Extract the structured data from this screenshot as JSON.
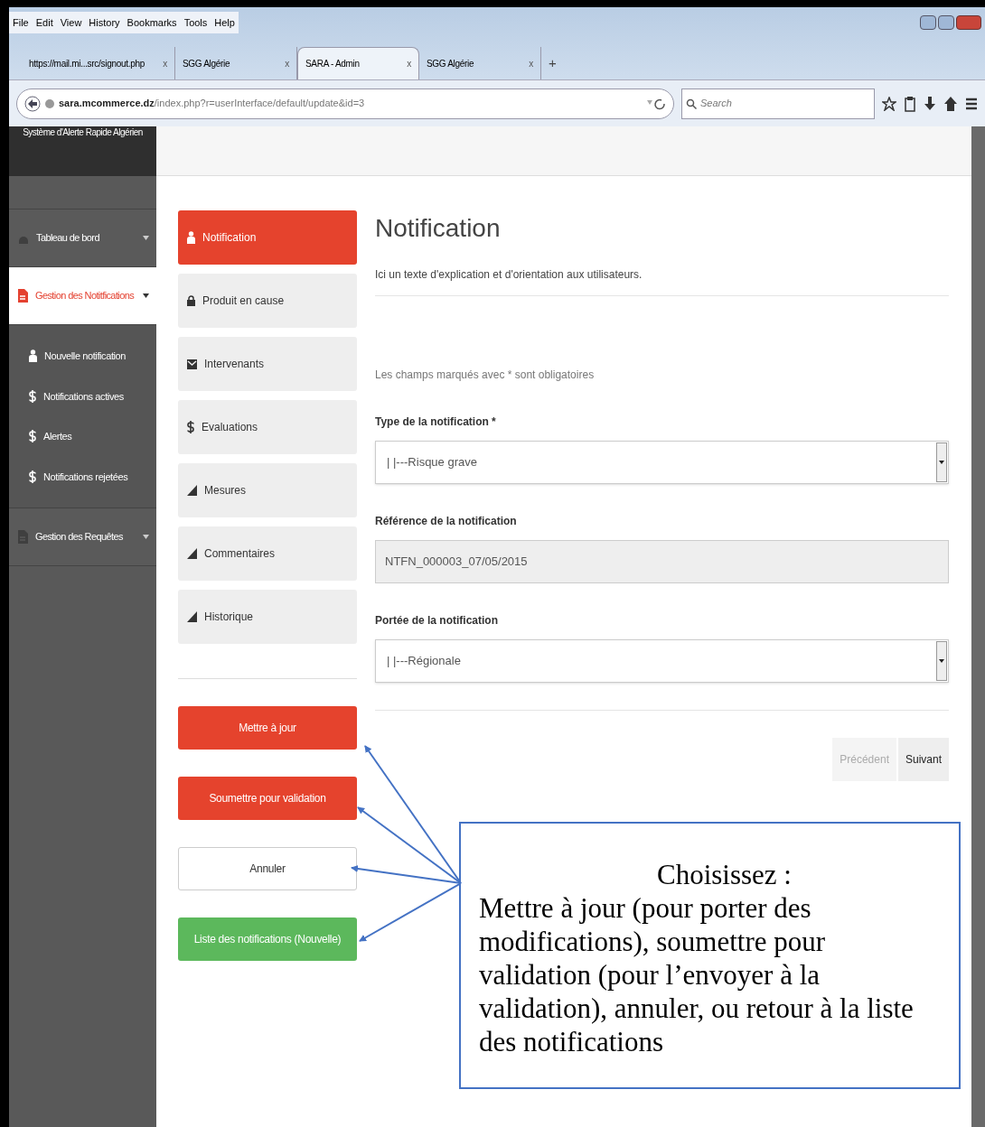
{
  "browser": {
    "menu": [
      "File",
      "Edit",
      "View",
      "History",
      "Bookmarks",
      "Tools",
      "Help"
    ],
    "tabs": [
      {
        "label": "https://mail.mi...src/signout.php",
        "close": "x",
        "selected": false
      },
      {
        "label": "SGG Algérie",
        "close": "x",
        "selected": false
      },
      {
        "label": "SARA - Admin",
        "close": "x",
        "selected": true
      },
      {
        "label": "SGG Algérie",
        "close": "x",
        "selected": false
      }
    ],
    "new_tab": "+",
    "address": {
      "host": "sara.mcommerce.dz",
      "path": "/index.php?r=userInterface/default/update&id=3"
    },
    "search": {
      "placeholder": "Search"
    }
  },
  "sidebar": {
    "brand": "Système d'Alerte Rapide Algérien",
    "items": [
      {
        "label": "Tableau de bord",
        "selected": false,
        "expanded": false
      },
      {
        "label": "Gestion des Notitfications",
        "selected": true,
        "expanded": true,
        "children": [
          {
            "label": "Nouvelle notification"
          },
          {
            "label": "Notifications actives"
          },
          {
            "label": "Alertes"
          },
          {
            "label": "Notifications rejetées"
          }
        ]
      },
      {
        "label": "Gestion des Requêtes",
        "selected": false,
        "expanded": false
      }
    ]
  },
  "steps": [
    {
      "label": "Notification",
      "selected": true
    },
    {
      "label": "Produit en cause",
      "selected": false
    },
    {
      "label": "Intervenants",
      "selected": false
    },
    {
      "label": "Evaluations",
      "selected": false
    },
    {
      "label": "Mesures",
      "selected": false
    },
    {
      "label": "Commentaires",
      "selected": false
    },
    {
      "label": "Historique",
      "selected": false
    }
  ],
  "actions": [
    {
      "label": "Mettre à jour",
      "kind": "danger"
    },
    {
      "label": "Soumettre pour validation",
      "kind": "danger"
    },
    {
      "label": "Annuler",
      "kind": "default"
    },
    {
      "label": "Liste des notifications (Nouvelle)",
      "kind": "success"
    }
  ],
  "form": {
    "title": "Notification",
    "description": "Ici un texte d'explication et d'orientation aux utilisateurs.",
    "required_note": "Les champs marqués avec * sont obligatoires",
    "fields": [
      {
        "label": "Type de la notification *",
        "kind": "select",
        "value": "| |---Risque grave"
      },
      {
        "label": "Référence de la notification",
        "kind": "readonly",
        "value": "NTFN_000003_07/05/2015"
      },
      {
        "label": "Portée de la notification",
        "kind": "select",
        "value": "| |---Régionale"
      }
    ],
    "pager": [
      {
        "label": "Précédent",
        "disabled": true
      },
      {
        "label": "Suivant",
        "disabled": false
      }
    ]
  },
  "callout": {
    "title": "Choisissez :",
    "body": "Mettre à jour (pour porter des modifications), soumettre pour validation (pour l’envoyer à la validation), annuler, ou retour à la liste des notifications"
  }
}
